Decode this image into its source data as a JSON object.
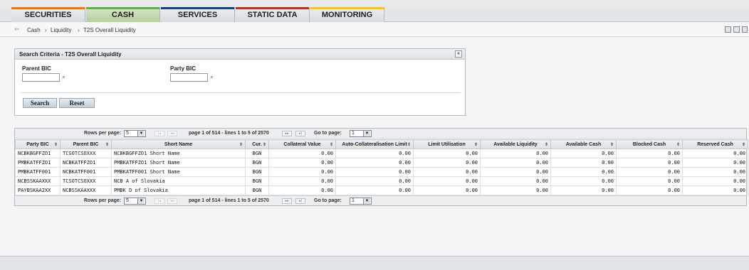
{
  "nav": {
    "tabs": [
      {
        "label": "SECURITIES",
        "accent": "#e87722"
      },
      {
        "label": "CASH",
        "accent": "#6aa84f",
        "active": true
      },
      {
        "label": "SERVICES",
        "accent": "#1f3f7a"
      },
      {
        "label": "STATIC DATA",
        "accent": "#b5352f"
      },
      {
        "label": "MONITORING",
        "accent": "#f1c232"
      }
    ]
  },
  "breadcrumb": {
    "items": [
      "Cash",
      "Liquidity",
      "T2S Overall Liquidity"
    ],
    "separator": "›"
  },
  "toolbar": {
    "icons": [
      "print-icon",
      "save-icon",
      "refresh-icon"
    ]
  },
  "search": {
    "title": "Search Criteria - T2S Overall Liquidity",
    "collapse_glyph": "«",
    "parent_bic_label": "Parent BIC",
    "parent_bic_value": "",
    "party_bic_label": "Party BIC",
    "party_bic_value": "",
    "search_button": "Search",
    "reset_button": "Reset"
  },
  "pager": {
    "rows_per_page_label": "Rows per page:",
    "rows_per_page": "5",
    "info": "page 1 of 514 - lines 1 to 5 of 2570",
    "goto_label": "Go to page:",
    "goto_page": "1",
    "first": "|◂",
    "prev": "◂◂",
    "next": "▸▸",
    "last": "▸|"
  },
  "table": {
    "columns": [
      "Party BIC",
      "Parent BIC",
      "Short Name",
      "Cur.",
      "Collateral Value",
      "Auto-Collateralisation Limit",
      "Limit Utilisation",
      "Available Liquidity",
      "Available Cash",
      "Blocked Cash",
      "Reserved Cash"
    ],
    "sort_glyph": "⇕",
    "rows": [
      [
        "NCBKBGFFZO1",
        "TCSOTCSOXXX",
        "NCBKBGFFZO1 Short Name",
        "BGN",
        "0.00",
        "0.00",
        "0.00",
        "0.00",
        "0.00",
        "0.00",
        "0.00"
      ],
      [
        "PMBKATFFZO1",
        "NCBKATFFZO1",
        "PMBKATFFZO1 Short Name",
        "BGN",
        "0.00",
        "0.00",
        "0.00",
        "0.00",
        "0.00",
        "0.00",
        "0.00"
      ],
      [
        "PMBKATFF001",
        "NCBKATFF001",
        "PMBKATFF001 Short Name",
        "BGN",
        "0.00",
        "0.00",
        "0.00",
        "0.00",
        "0.00",
        "0.00",
        "0.00"
      ],
      [
        "NCBSSKAAXXX",
        "TCSOTCSOXXX",
        "NCB A of Slovakia",
        "BGN",
        "0.00",
        "0.00",
        "0.00",
        "0.00",
        "0.00",
        "0.00",
        "0.00"
      ],
      [
        "PAYBSKAA2XX",
        "NCBSSKAAXXX",
        "PMBK D of Slovakia",
        "BGN",
        "0.00",
        "0.00",
        "0.00",
        "0.00",
        "0.00",
        "0.00",
        "0.00"
      ]
    ]
  }
}
